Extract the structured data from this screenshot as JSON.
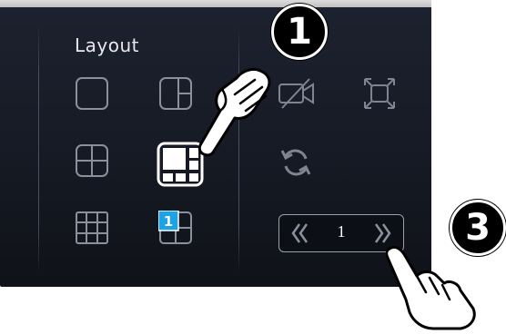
{
  "panel": {
    "title": "Layout"
  },
  "layout_buttons": [
    {
      "id": "single",
      "icon": "single-view-icon"
    },
    {
      "id": "split",
      "icon": "split-view-icon"
    },
    {
      "id": "quad",
      "icon": "quad-view-icon"
    },
    {
      "id": "focus-6",
      "icon": "focus-six-view-icon",
      "selected": true
    },
    {
      "id": "grid-9",
      "icon": "nine-grid-view-icon"
    },
    {
      "id": "picture-in-picture",
      "icon": "pip-view-icon",
      "badge": "1"
    }
  ],
  "tool_buttons": [
    {
      "id": "camera-off",
      "icon": "camera-off-icon"
    },
    {
      "id": "fullscreen",
      "icon": "fullscreen-icon"
    },
    {
      "id": "refresh",
      "icon": "refresh-icon"
    }
  ],
  "pager": {
    "page": "1",
    "prev_glyph": "《",
    "next_glyph": "》"
  },
  "callouts": [
    {
      "id": "step-1",
      "label": "1"
    },
    {
      "id": "step-3",
      "label": "3"
    }
  ],
  "colors": {
    "panel_bg": "#161a24",
    "icon_stroke": "#8a909c",
    "selected_stroke": "#ffffff",
    "badge": "#1aa3e8"
  }
}
